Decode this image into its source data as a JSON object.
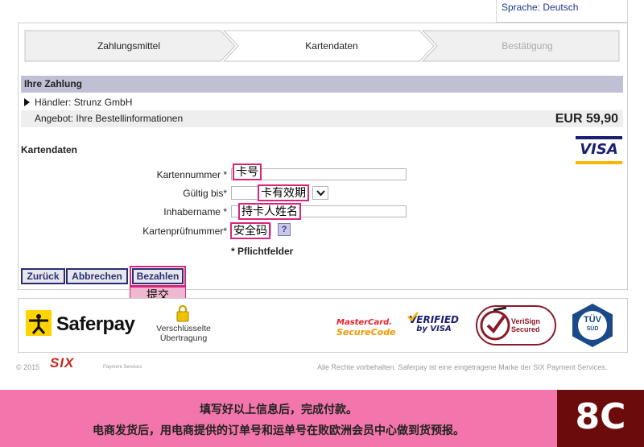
{
  "language": {
    "label": "Sprache: Deutsch"
  },
  "steps": [
    "Zahlungsmittel",
    "Kartendaten",
    "Bestätigung"
  ],
  "payment": {
    "header": "Ihre Zahlung",
    "merchant": "Händler: Strunz GmbH",
    "offer": "Angebot: Ihre Bestellinformationen",
    "amount": "EUR 59,90"
  },
  "card": {
    "title": "Kartendaten",
    "brand": "VISA",
    "fields": {
      "number_label": "Kartennummer *",
      "expiry_label": "Gültig bis*",
      "holder_label": "Inhabername *",
      "cvc_label": "Kartenprüfnummer*"
    },
    "annotations": {
      "number": "卡号",
      "expiry": "卡有效期",
      "holder": "持卡人姓名",
      "cvc": "安全码",
      "submit": "提交"
    },
    "help": "?",
    "required_note": "* Pflichtfelder"
  },
  "buttons": {
    "back": "Zurück",
    "cancel": "Abbrechen",
    "pay": "Bezahlen"
  },
  "logos": {
    "saferpay": "Saferpay",
    "secure_transfer_l1": "Verschlüsselte",
    "secure_transfer_l2": "Übertragung",
    "mastercard_l1": "MasterCard.",
    "mastercard_l2": "SecureCode",
    "verified_l1": "VERIFIED",
    "verified_l2": "by VISA",
    "verisign_l1": "VeriSign",
    "verisign_l2": "Secured",
    "tuv_l1": "TÜV",
    "tuv_l2": "SÜD"
  },
  "footer": {
    "copyright": "© 2015",
    "six": "SIX",
    "six_sub": "Payment Services",
    "rights": "Alle Rechte vorbehalten. Saferpay ist eine eingetragene Marke der SIX Payment Services."
  },
  "banner": {
    "line1": "填写好以上信息后，完成付款。",
    "line2": "电商发货后，用电商提供的订单号和运单号在败欧洲会员中心做到货预报。",
    "brand": "8C"
  },
  "colors": {
    "accent": "#2a2f73",
    "annotation": "#d9267a",
    "banner": "#f276ab",
    "brand_bg": "#6b0b0b"
  }
}
